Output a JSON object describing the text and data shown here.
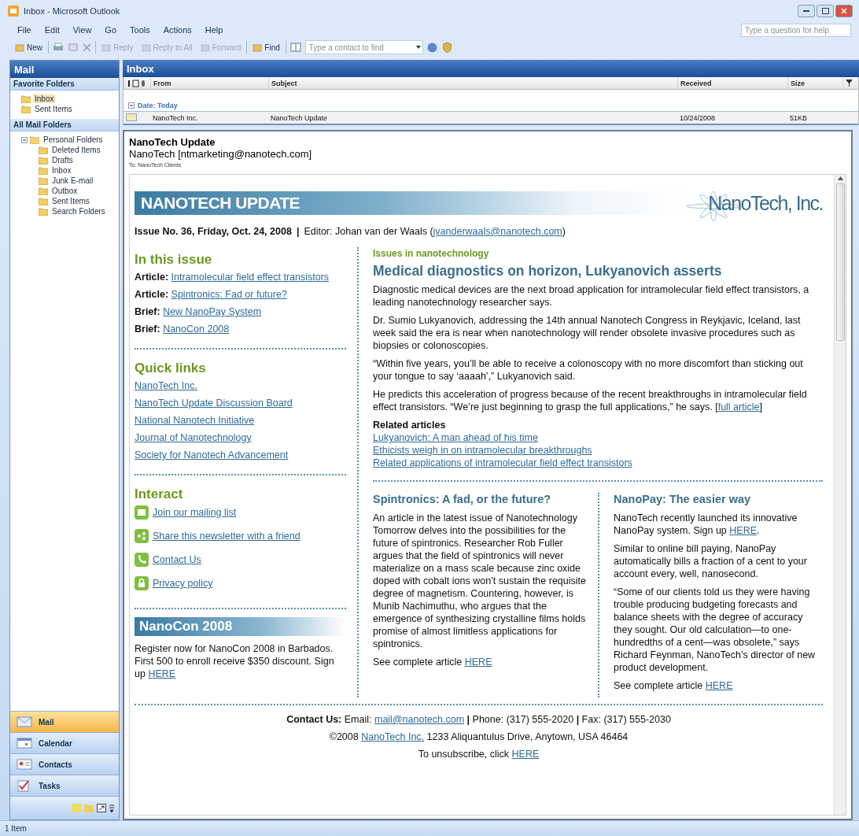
{
  "window": {
    "title": "Inbox - Microsoft Outlook"
  },
  "menu": [
    "File",
    "Edit",
    "View",
    "Go",
    "Tools",
    "Actions",
    "Help"
  ],
  "help_placeholder": "Type a question for help",
  "toolbar": {
    "buttons": [
      {
        "label": "New",
        "disabled": false
      },
      {
        "label": "Reply",
        "disabled": true
      },
      {
        "label": "Reply to All",
        "disabled": true
      },
      {
        "label": "Forward",
        "disabled": true
      },
      {
        "label": "Find",
        "disabled": false
      }
    ],
    "contact_placeholder": "Type a contact to find"
  },
  "nav": {
    "title": "Mail",
    "favorites_title": "Favorite Folders",
    "favorites": [
      {
        "label": "Inbox",
        "selected": true
      },
      {
        "label": "Sent Items",
        "selected": false
      }
    ],
    "all_title": "All Mail Folders",
    "tree": {
      "label": "Personal Folders",
      "expanded": true,
      "children": [
        {
          "label": "Deleted Items"
        },
        {
          "label": "Drafts"
        },
        {
          "label": "Inbox"
        },
        {
          "label": "Junk E-mail"
        },
        {
          "label": "Outbox"
        },
        {
          "label": "Sent Items"
        },
        {
          "label": "Search Folders"
        }
      ]
    },
    "buttons": [
      {
        "label": "Mail",
        "selected": true
      },
      {
        "label": "Calendar",
        "selected": false
      },
      {
        "label": "Contacts",
        "selected": false
      },
      {
        "label": "Tasks",
        "selected": false
      }
    ]
  },
  "inbox": {
    "title": "Inbox",
    "columns": [
      "From",
      "Subject",
      "Received",
      "Size"
    ],
    "group": "Date: Today",
    "rows": [
      {
        "from": "NanoTech Inc.",
        "subject": "NanoTech Update",
        "received": "10/24/2008",
        "size": "51KB",
        "selected": false
      }
    ]
  },
  "message": {
    "subject": "NanoTech Update",
    "sender": "NanoTech [ntmarketing@nanotech.com]",
    "to": "To: NanoTech Clients"
  },
  "newsletter": {
    "banner": "NANOTECH UPDATE",
    "logo": "NanoTech, Inc.",
    "issue": "Issue No. 36, Friday, Oct. 24, 2008",
    "issue_separator": "|",
    "editor": [
      {
        "text": "Editor: Johan van der Waals ("
      },
      {
        "link": "jvanderwaals@nanotech.com"
      },
      {
        "text": ")"
      }
    ],
    "in_this_issue": {
      "title": "In this issue",
      "items": [
        {
          "kind": "Article:",
          "link": "Intramolecular field effect transistors"
        },
        {
          "kind": "Article:",
          "link": "Spintronics: Fad or future?"
        },
        {
          "kind": "Brief:",
          "link": "New NanoPay System"
        },
        {
          "kind": "Brief:",
          "link": "NanoCon 2008"
        }
      ]
    },
    "quick_links": {
      "title": "Quick links",
      "links": [
        "NanoTech Inc.",
        "NanoTech Update Discussion Board",
        "National Nanotech Initiative",
        "Journal of Nanotechnology",
        "Society for Nanotech Advancement"
      ]
    },
    "interact": {
      "title": "Interact",
      "items": [
        {
          "kind": "mail",
          "link": "Join our mailing list"
        },
        {
          "kind": "share",
          "link": "Share this newsletter with a friend"
        },
        {
          "kind": "phone",
          "link": "Contact Us"
        },
        {
          "kind": "lock",
          "link": "Privacy policy"
        }
      ]
    },
    "nanocon": {
      "banner": "NanoCon 2008",
      "text": [
        {
          "text": "Register now for NanoCon 2008 in Barbados. First 500 to enroll receive $350 discount. Sign up "
        },
        {
          "link": "HERE"
        }
      ]
    },
    "feature": {
      "section": "Issues in nanotechnology",
      "headline": "Medical diagnostics on horizon, Lukyanovich asserts",
      "paragraphs": [
        [
          {
            "text": "Diagnostic medical devices are the next broad application for intramolecular field effect transistors, a leading nanotechnology researcher says."
          }
        ],
        [
          {
            "text": "Dr. Sumio Lukyanovich, addressing the 14th annual Nanotech Congress in Reykjavic, Iceland, last week said the era is near when nanotechnology will render obsolete invasive procedures such as biopsies or colonoscopies."
          }
        ],
        [
          {
            "text": "“Within five years, you’ll be able to receive a colonoscopy with no more discomfort than sticking out your tongue to say ‘aaaah’,” Lukyanovich said."
          }
        ],
        [
          {
            "text": "He predicts this acceleration of progress because of the recent breakthroughs in intramolecular field effect transistors. “We’re just beginning to grasp the full applications,” he says. ["
          },
          {
            "link": "full article"
          },
          {
            "text": "]"
          }
        ]
      ],
      "related_title": "Related articles",
      "related": [
        "Lukyanovich: A man ahead of his time",
        "Ethicists weigh in on intramolecular breakthroughs",
        "Related applications of intramolecular field effect transistors"
      ]
    },
    "articles": [
      {
        "title": "Spintronics: A fad, or the future?",
        "paragraphs": [
          [
            {
              "text": "An article in the latest issue of Nanotechnology Tomorrow delves into the possibilities for the future of spintronics. Researcher Rob Fuller argues that the field of spintronics will never materialize on a mass scale because zinc oxide doped with cobalt ions won’t sustain the requisite degree of magnetism. Countering, however, is Munib Nachimuthu, who argues that the emergence of synthesizing crystalline films holds promise of almost limitless applications for spintronics."
            }
          ],
          [
            {
              "text": "See complete article "
            },
            {
              "link": "HERE"
            }
          ]
        ]
      },
      {
        "title": "NanoPay: The easier way",
        "paragraphs": [
          [
            {
              "text": "NanoTech recently launched its innovative NanoPay system. Sign up "
            },
            {
              "link": "HERE"
            },
            {
              "text": "."
            }
          ],
          [
            {
              "text": "Similar to online bill paying, NanoPay automatically bills a fraction of a cent to your account every, well, nanosecond."
            }
          ],
          [
            {
              "text": "“Some of our clients told us they were having trouble producing budgeting forecasts and balance sheets with the degree of accuracy they sought. Our old calculation—to one-hundredths of a cent—was obsolete,” says Richard Feynman, NanoTech’s director of new product development."
            }
          ],
          [
            {
              "text": "See complete article "
            },
            {
              "link": "HERE"
            }
          ]
        ]
      }
    ],
    "footer": [
      [
        {
          "text": "**Contact Us:** Email: "
        },
        {
          "link": "mail@nanotech.com"
        },
        {
          "text": "  **|**  Phone: (317) 555-2020  **|**  Fax: (317) 555-2030"
        }
      ],
      [
        {
          "text": "©2008 "
        },
        {
          "link": "NanoTech Inc."
        },
        {
          "text": " 1233 Aliquantulus Drive, Anytown, USA 46464"
        }
      ],
      [
        {
          "text": "To unsubscribe, click "
        },
        {
          "link": "HERE"
        }
      ]
    ]
  },
  "status": "1 Item"
}
